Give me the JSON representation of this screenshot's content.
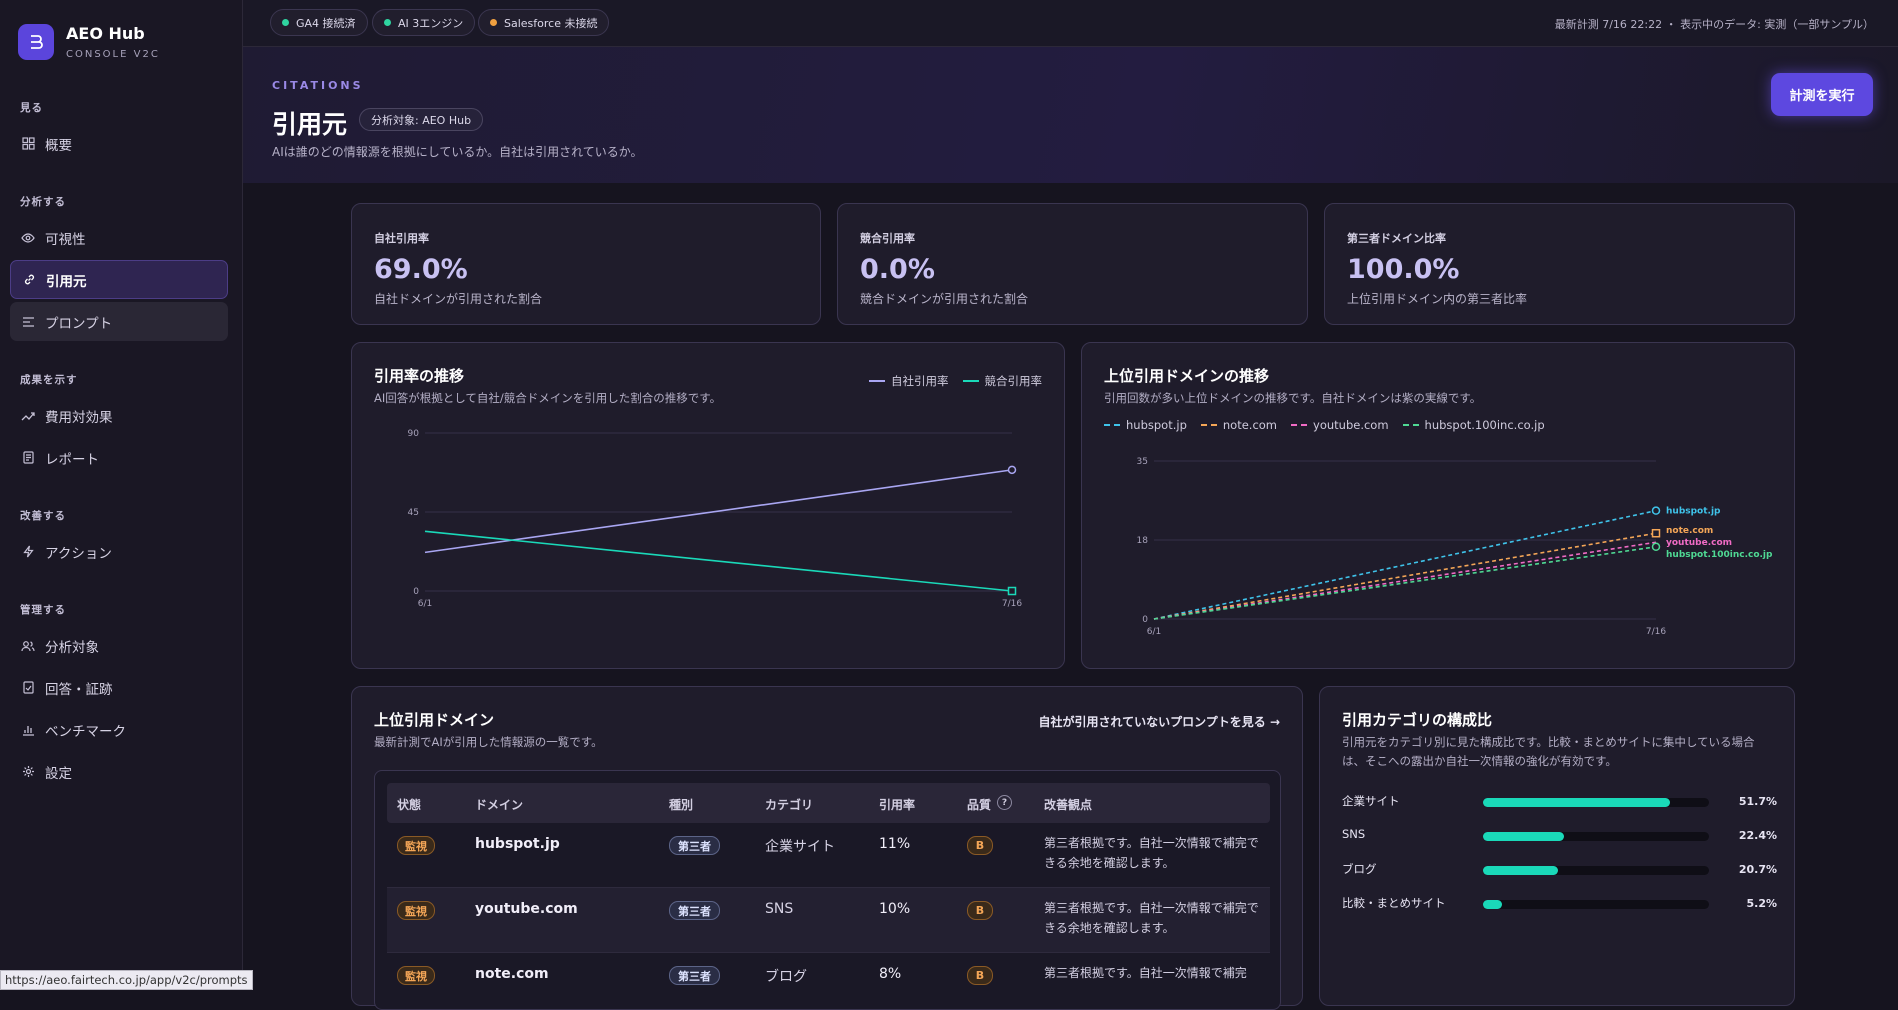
{
  "brand": {
    "name": "AEO Hub",
    "subtitle": "CONSOLE V2C"
  },
  "sidebar": {
    "sections": [
      {
        "title": "見る",
        "items": [
          {
            "label": "概要",
            "icon": "grid-icon"
          }
        ]
      },
      {
        "title": "分析する",
        "items": [
          {
            "label": "可視性",
            "icon": "eye-icon"
          },
          {
            "label": "引用元",
            "icon": "link-icon",
            "active": true
          },
          {
            "label": "プロンプト",
            "icon": "list-icon"
          }
        ]
      },
      {
        "title": "成果を示す",
        "items": [
          {
            "label": "費用対効果",
            "icon": "trend-icon"
          },
          {
            "label": "レポート",
            "icon": "document-icon"
          }
        ]
      },
      {
        "title": "改善する",
        "items": [
          {
            "label": "アクション",
            "icon": "bolt-icon"
          }
        ]
      },
      {
        "title": "管理する",
        "items": [
          {
            "label": "分析対象",
            "icon": "users-icon"
          },
          {
            "label": "回答・証跡",
            "icon": "check-document-icon"
          },
          {
            "label": "ベンチマーク",
            "icon": "bar-chart-icon"
          },
          {
            "label": "設定",
            "icon": "gear-icon"
          }
        ]
      }
    ]
  },
  "topbar": {
    "pills": [
      {
        "label": "GA4 接続済",
        "color": "#2fd4a0"
      },
      {
        "label": "AI 3エンジン",
        "color": "#2fd4a0"
      },
      {
        "label": "Salesforce 未接続",
        "color": "#f0a040"
      }
    ],
    "status": "最新計測 7/16 22:22 ・ 表示中のデータ: 実測（一部サンプル）"
  },
  "header": {
    "eyebrow": "CITATIONS",
    "title": "引用元",
    "target_badge": "分析対象: AEO Hub",
    "description": "AIは誰のどの情報源を根拠にしているか。自社は引用されているか。",
    "run_button": "計測を実行"
  },
  "kpis": [
    {
      "label": "自社引用率",
      "value": "69.0%",
      "sub": "自社ドメインが引用された割合"
    },
    {
      "label": "競合引用率",
      "value": "0.0%",
      "sub": "競合ドメインが引用された割合"
    },
    {
      "label": "第三者ドメイン比率",
      "value": "100.0%",
      "sub": "上位引用ドメイン内の第三者比率"
    }
  ],
  "rate_chart": {
    "title": "引用率の推移",
    "description": "AI回答が根拠として自社/競合ドメインを引用した割合の推移です。"
  },
  "domain_chart": {
    "title": "上位引用ドメインの推移",
    "description": "引用回数が多い上位ドメインの推移です。自社ドメインは紫の実線です。"
  },
  "chart_data": [
    {
      "type": "line",
      "x": [
        "6/1",
        "7/16"
      ],
      "ylim": [
        0,
        90
      ],
      "yticks": [
        "90",
        "45",
        "0"
      ],
      "series": [
        {
          "name": "自社引用率",
          "values": [
            22,
            69
          ],
          "color": "#a9a6f2",
          "marker": "circle"
        },
        {
          "name": "競合引用率",
          "values": [
            34,
            0
          ],
          "color": "#1ad9b9",
          "marker": "square"
        }
      ]
    },
    {
      "type": "line",
      "x": [
        "6/1",
        "7/16"
      ],
      "ylim": [
        0,
        35
      ],
      "yticks": [
        "35",
        "18",
        "0"
      ],
      "series": [
        {
          "name": "hubspot.jp",
          "values": [
            0,
            24
          ],
          "color": "#3fc3ea",
          "marker": "circle"
        },
        {
          "name": "note.com",
          "values": [
            0,
            19
          ],
          "color": "#f4a657",
          "marker": "square"
        },
        {
          "name": "youtube.com",
          "values": [
            0,
            17
          ],
          "color": "#f06bc5",
          "marker": "none"
        },
        {
          "name": "hubspot.100inc.co.jp",
          "values": [
            0,
            16
          ],
          "color": "#4fd994",
          "marker": "circle"
        }
      ]
    }
  ],
  "domains_table": {
    "title": "上位引用ドメイン",
    "description": "最新計測でAIが引用した情報源の一覧です。",
    "link": "自社が引用されていないプロンプトを見る →",
    "columns": [
      "状態",
      "ドメイン",
      "種別",
      "カテゴリ",
      "引用率",
      "品質",
      "改善観点"
    ],
    "quality_help": "?",
    "rows": [
      {
        "status": "監視",
        "domain": "hubspot.jp",
        "type": "第三者",
        "category": "企業サイト",
        "rate": "11%",
        "quality": "B",
        "note": "第三者根拠です。自社一次情報で補完できる余地を確認します。"
      },
      {
        "status": "監視",
        "domain": "youtube.com",
        "type": "第三者",
        "category": "SNS",
        "rate": "10%",
        "quality": "B",
        "note": "第三者根拠です。自社一次情報で補完できる余地を確認します。"
      },
      {
        "status": "監視",
        "domain": "note.com",
        "type": "第三者",
        "category": "ブログ",
        "rate": "8%",
        "quality": "B",
        "note": "第三者根拠です。自社一次情報で補完"
      }
    ]
  },
  "category_breakdown": {
    "title": "引用カテゴリの構成比",
    "description": "引用元をカテゴリ別に見た構成比です。比較・まとめサイトに集中している場合は、そこへの露出か自社一次情報の強化が有効です。",
    "items": [
      {
        "label": "企業サイト",
        "pct": "51.7%",
        "value": 51.7
      },
      {
        "label": "SNS",
        "pct": "22.4%",
        "value": 22.4
      },
      {
        "label": "ブログ",
        "pct": "20.7%",
        "value": 20.7
      },
      {
        "label": "比較・まとめサイト",
        "pct": "5.2%",
        "value": 5.2
      }
    ]
  },
  "status_url": "https://aeo.fairtech.co.jp/app/v2c/prompts"
}
